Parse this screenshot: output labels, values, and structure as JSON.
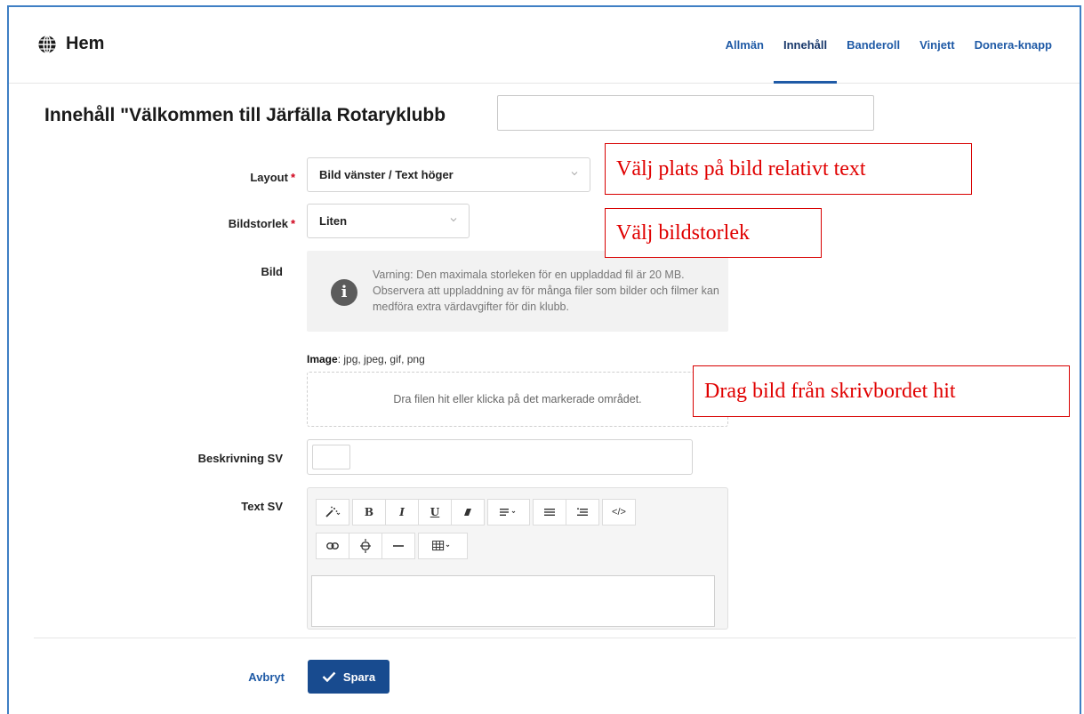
{
  "header": {
    "title": "Hem",
    "tabs": [
      {
        "label": "Allmän",
        "active": false
      },
      {
        "label": "Innehåll",
        "active": true
      },
      {
        "label": "Banderoll",
        "active": false
      },
      {
        "label": "Vinjett",
        "active": false
      },
      {
        "label": "Donera-knapp",
        "active": false
      }
    ]
  },
  "page_title": "Innehåll \"Välkommen till Järfälla Rotaryklubb",
  "title_input_value": "",
  "form": {
    "layout_label": "Layout",
    "layout_value": "Bild vänster / Text höger",
    "size_label": "Bildstorlek",
    "size_value": "Liten",
    "required_mark": "*",
    "image_label": "Bild",
    "warning_text": "Varning: Den maximala storleken för en uppladdad fil är 20 MB. Observera att uppladdning av för många filer som bilder och filmer kan medföra extra värdavgifter för din klubb.",
    "file_types_label": "Image",
    "file_types": ": jpg, jpeg, gif, png",
    "dropzone_text": "Dra filen hit eller klicka på det markerade området.",
    "description_label": "Beskrivning SV",
    "text_label": "Text SV"
  },
  "actions": {
    "cancel_label": "Avbryt",
    "save_label": "Spara"
  },
  "annotations": {
    "layout_note": "Välj plats på bild relativt text",
    "size_note": "Välj bildstorlek",
    "drag_note": "Drag bild från skrivbordet hit"
  },
  "colors": {
    "link_blue": "#1f5aa6",
    "save_button": "#184b8f",
    "annotation_red": "#e00000",
    "required_red": "#d0021b"
  }
}
